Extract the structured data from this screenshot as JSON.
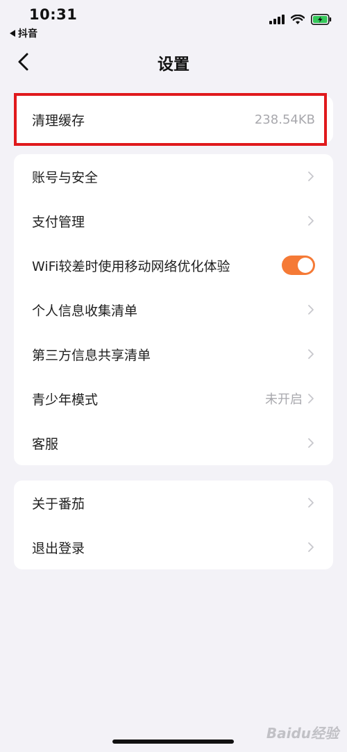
{
  "status_bar": {
    "time": "10:31",
    "back_app": "抖音"
  },
  "nav": {
    "title": "设置"
  },
  "cache": {
    "label": "清理缓存",
    "value": "238.54KB"
  },
  "settings_group": {
    "items": [
      {
        "label": "账号与安全",
        "value": ""
      },
      {
        "label": "支付管理",
        "value": ""
      },
      {
        "label": "WiFi较差时使用移动网络优化体验",
        "value": ""
      },
      {
        "label": "个人信息收集清单",
        "value": ""
      },
      {
        "label": "第三方信息共享清单",
        "value": ""
      },
      {
        "label": "青少年模式",
        "value": "未开启"
      },
      {
        "label": "客服",
        "value": ""
      }
    ],
    "wifi_toggle_on": true
  },
  "about_group": {
    "items": [
      {
        "label": "关于番茄"
      },
      {
        "label": "退出登录"
      }
    ]
  },
  "watermark": "Baidu经验",
  "colors": {
    "background": "#f3f2f7",
    "accent_toggle": "#f57a36",
    "highlight_border": "#e0191c"
  }
}
